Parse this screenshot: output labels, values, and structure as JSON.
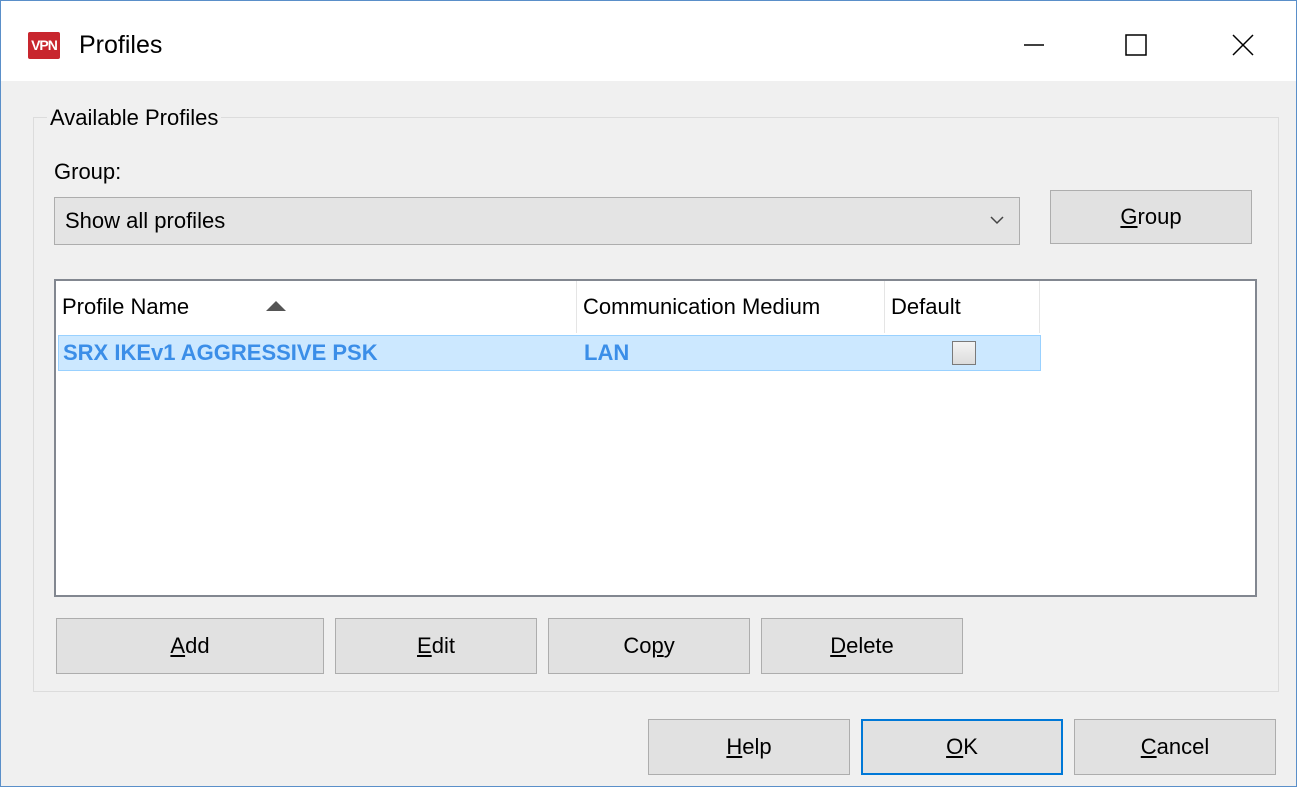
{
  "window": {
    "app_icon_text": "VPN",
    "title": "Profiles"
  },
  "groupbox": {
    "label": "Available Profiles"
  },
  "group": {
    "label": "Group:",
    "selected": "Show all profiles",
    "button_label": "Group",
    "button_mnemonic": "G",
    "button_rest": "roup"
  },
  "list": {
    "columns": [
      "Profile Name",
      "Communication Medium",
      "Default"
    ],
    "sort_column": "Profile Name",
    "sort_direction": "ascending",
    "rows": [
      {
        "profile_name": "SRX IKEv1 AGGRESSIVE PSK",
        "communication_medium": "LAN",
        "default": false,
        "selected": true
      }
    ]
  },
  "actions": {
    "add": {
      "mn": "A",
      "rest": "dd"
    },
    "edit": {
      "mn": "E",
      "rest": "dit"
    },
    "copy": {
      "pre": "Co",
      "mn": "p",
      "rest": "y"
    },
    "delete": {
      "mn": "D",
      "rest": "elete"
    }
  },
  "footer": {
    "help": {
      "mn": "H",
      "rest": "elp"
    },
    "ok": {
      "mn": "O",
      "rest": "K"
    },
    "cancel": {
      "mn": "C",
      "rest": "ancel"
    }
  },
  "colors": {
    "selection_bg": "#cce8ff",
    "selection_text": "#3b8ee8",
    "default_button_border": "#0078d7",
    "icon_red": "#c8262e"
  }
}
